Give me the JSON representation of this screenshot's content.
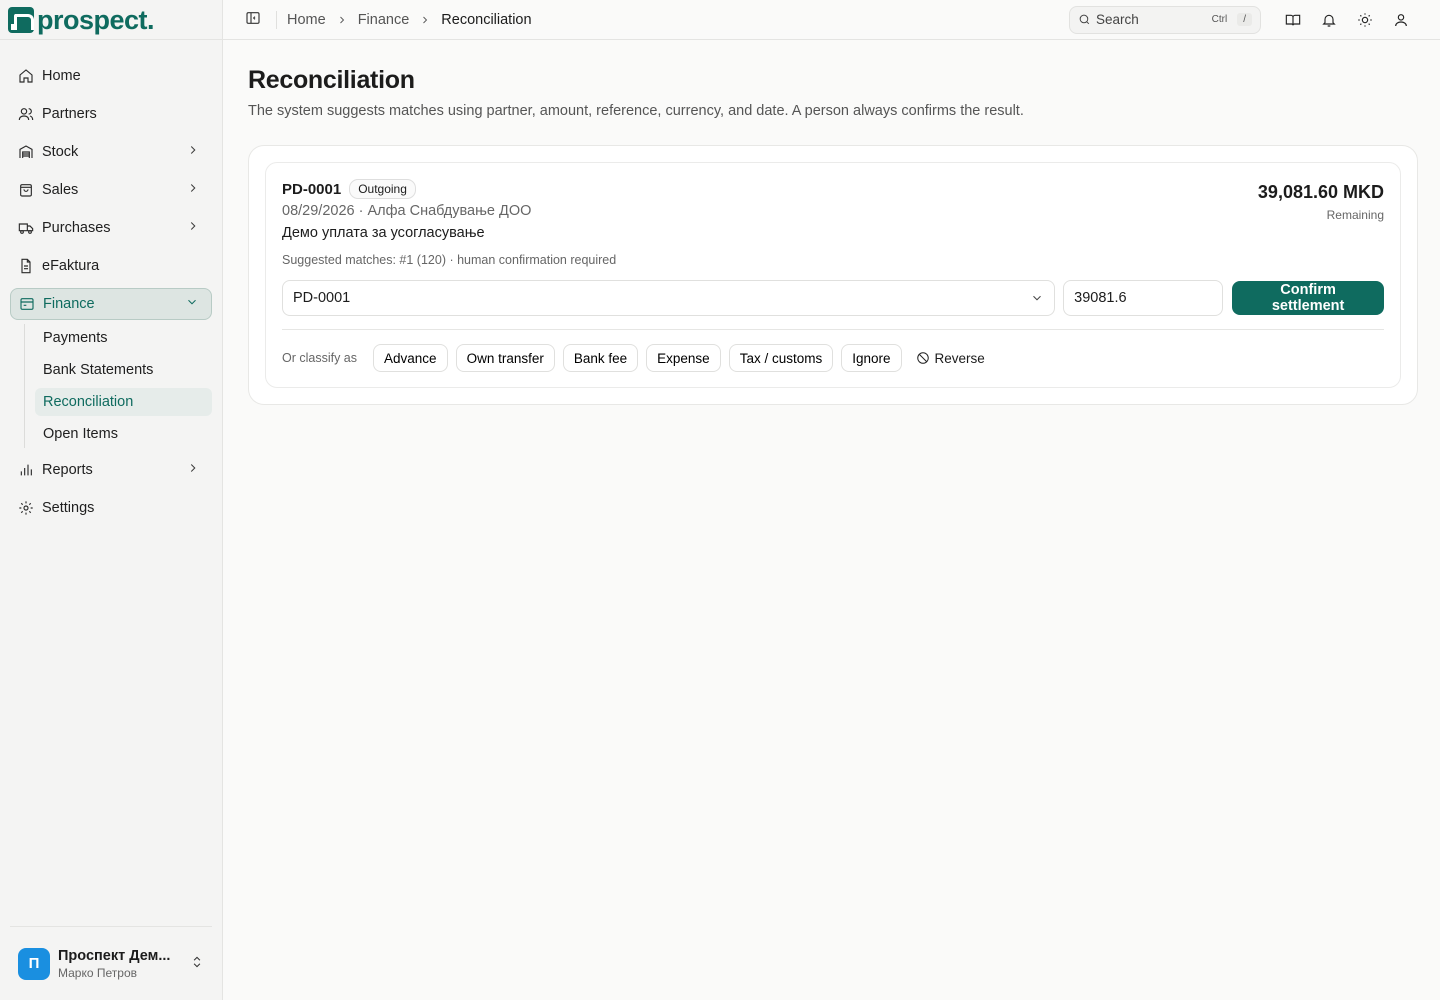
{
  "app": {
    "logo_text": "prospect."
  },
  "sidebar": {
    "items": [
      {
        "label": "Home",
        "icon": "home-icon"
      },
      {
        "label": "Partners",
        "icon": "users-icon"
      },
      {
        "label": "Stock",
        "icon": "warehouse-icon"
      },
      {
        "label": "Sales",
        "icon": "shopping-bag-icon"
      },
      {
        "label": "Purchases",
        "icon": "truck-icon"
      },
      {
        "label": "eFaktura",
        "icon": "file-text-icon"
      },
      {
        "label": "Finance",
        "icon": "wallet-icon"
      },
      {
        "label": "Reports",
        "icon": "bar-chart-icon"
      },
      {
        "label": "Settings",
        "icon": "gear-icon"
      }
    ],
    "finance_sub": [
      "Payments",
      "Bank Statements",
      "Reconciliation",
      "Open Items"
    ],
    "user": {
      "avatar_letter": "П",
      "name": "Проспект Дем...",
      "person": "Марко Петров"
    }
  },
  "topbar": {
    "breadcrumb": [
      "Home",
      "Finance",
      "Reconciliation"
    ],
    "search_placeholder": "Search",
    "shortcut_key1": "Ctrl",
    "shortcut_key2": "/"
  },
  "page": {
    "title": "Reconciliation",
    "description": "The system suggests matches using partner, amount, reference, currency, and date. A person always confirms the result."
  },
  "item": {
    "doc_id": "PD-0001",
    "direction_badge": "Outgoing",
    "meta": "08/29/2026 · Алфа Снабдување ДОО",
    "memo": "Демо уплата за усогласување",
    "amount": "39,081.60 MKD",
    "amount_caption": "Remaining",
    "suggestion": "Suggested matches: #1 (120) · human confirmation required",
    "selected_match": "PD-0001",
    "amount_input": "39081.6",
    "confirm_label": "Confirm settlement",
    "classify_label": "Or classify as",
    "classify_options": [
      "Advance",
      "Own transfer",
      "Bank fee",
      "Expense",
      "Tax / customs",
      "Ignore"
    ],
    "reverse_label": "Reverse"
  },
  "colors": {
    "brand": "#0f6b5f",
    "avatar": "#1a8fe0"
  }
}
